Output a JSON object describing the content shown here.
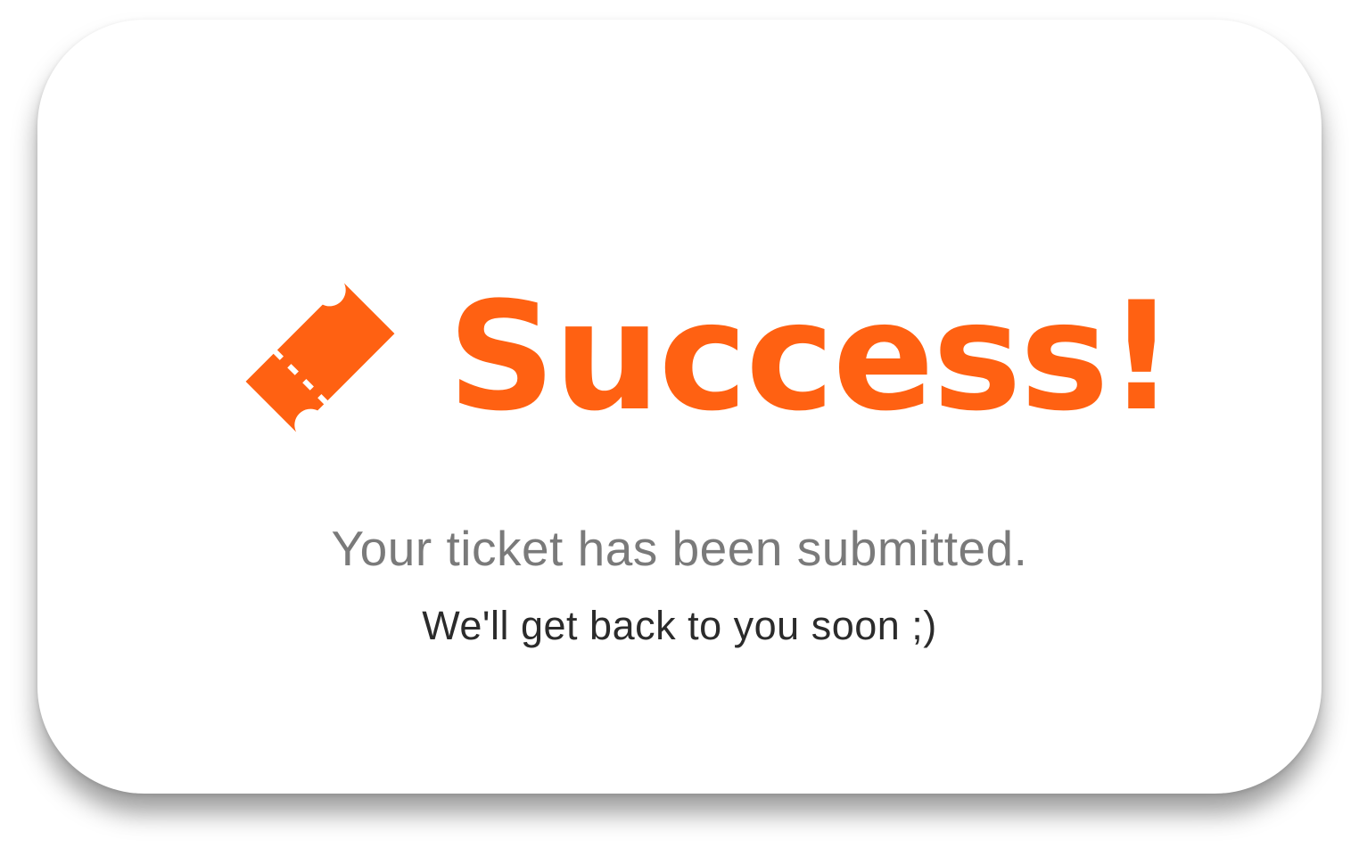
{
  "dialog": {
    "title": "Success!",
    "message": "Your ticket has been submitted.",
    "submessage": "We'll get back to you soon ;)",
    "icon": "ticket-icon"
  },
  "colors": {
    "accent": "#FF6112",
    "message": "#7A7A7A",
    "submessage": "#2B2B2B",
    "card": "#FFFFFF"
  }
}
